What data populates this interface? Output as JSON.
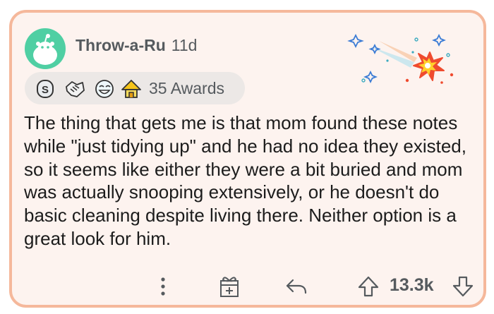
{
  "post": {
    "author": "Throw-a-Ru",
    "age": "11d",
    "awards_label": "35 Awards",
    "body": "The thing that gets me is that mom found these notes while \"just tidying up\" and he had no idea they existed, so it seems like either they were a bit buried and mom was actually snooping extensively, or he doesn't do basic cleaning despite living there. Neither option is a great look for him.",
    "vote_count": "13.3k"
  },
  "icons": {
    "avatar": "reddit-snoo-avatar",
    "awards": [
      "silver-coin-award-icon",
      "handshake-award-icon",
      "laughing-face-award-icon",
      "gold-house-award-icon"
    ],
    "decoration": "starburst-explosion-icon",
    "more": "vertical-dots-icon",
    "gift": "gift-icon",
    "reply": "reply-arrow-icon",
    "upvote": "upvote-arrow-icon",
    "downvote": "downvote-arrow-icon"
  },
  "colors": {
    "card_border": "#f5b89b",
    "card_background": "#fdf3ef",
    "avatar": "#4fcfa3",
    "muted_text": "#555a5e"
  }
}
